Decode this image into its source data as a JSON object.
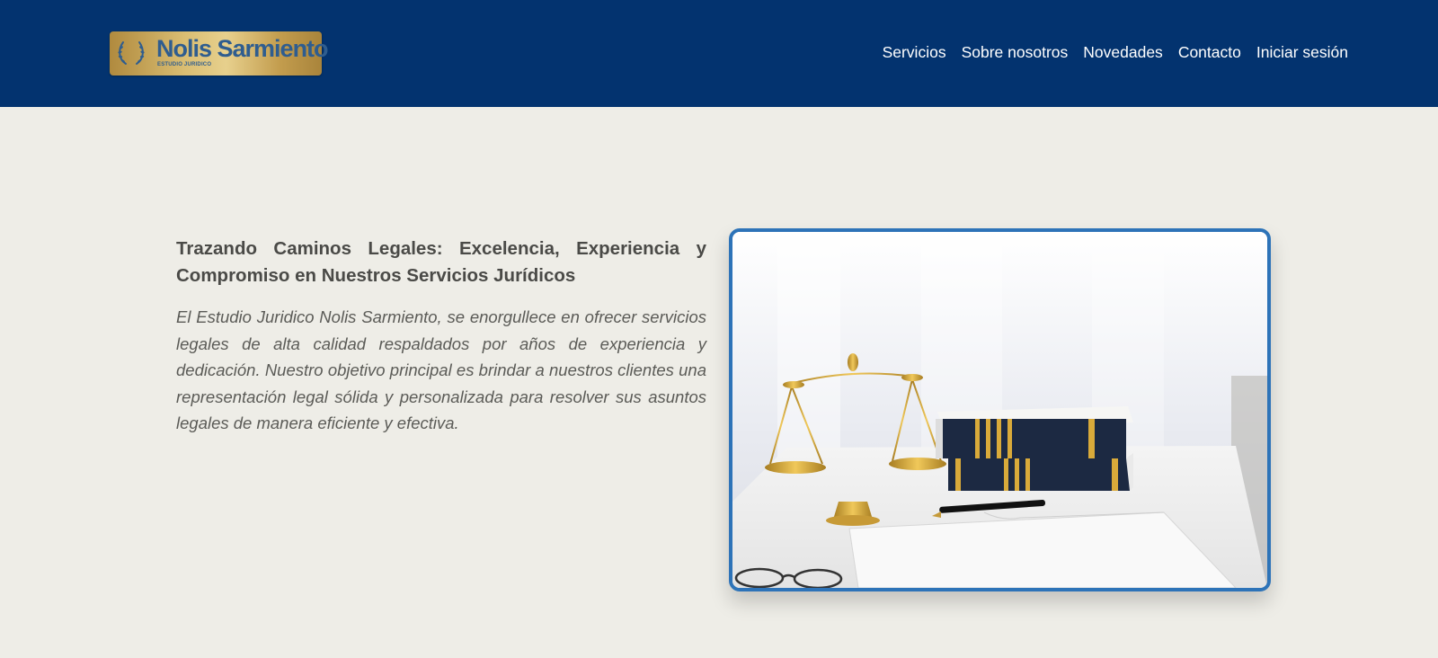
{
  "header": {
    "logo": {
      "name": "Nolis Sarmiento",
      "subtitle": "ESTUDIO JURIDICO"
    },
    "nav": [
      {
        "label": "Servicios"
      },
      {
        "label": "Sobre nosotros"
      },
      {
        "label": "Novedades"
      },
      {
        "label": "Contacto"
      },
      {
        "label": "Iniciar sesión"
      }
    ]
  },
  "hero": {
    "title": "Trazando Caminos Legales: Excelencia, Experiencia y Compromiso en Nuestros Servicios Jurídicos",
    "description": "El Estudio Juridico Nolis Sarmiento, se enorgullece en ofrecer servicios legales de alta calidad respaldados por años de experiencia y dedicación. Nuestro objetivo principal es brindar a nuestros clientes una representación legal sólida y personalizada para resolver sus asuntos legales de manera eficiente y efectiva."
  },
  "colors": {
    "header_bg": "#03336f",
    "page_bg": "#eeede7",
    "image_border": "#2d73b8",
    "logo_text": "#2f5d8f",
    "gold": "#c9a24a"
  }
}
